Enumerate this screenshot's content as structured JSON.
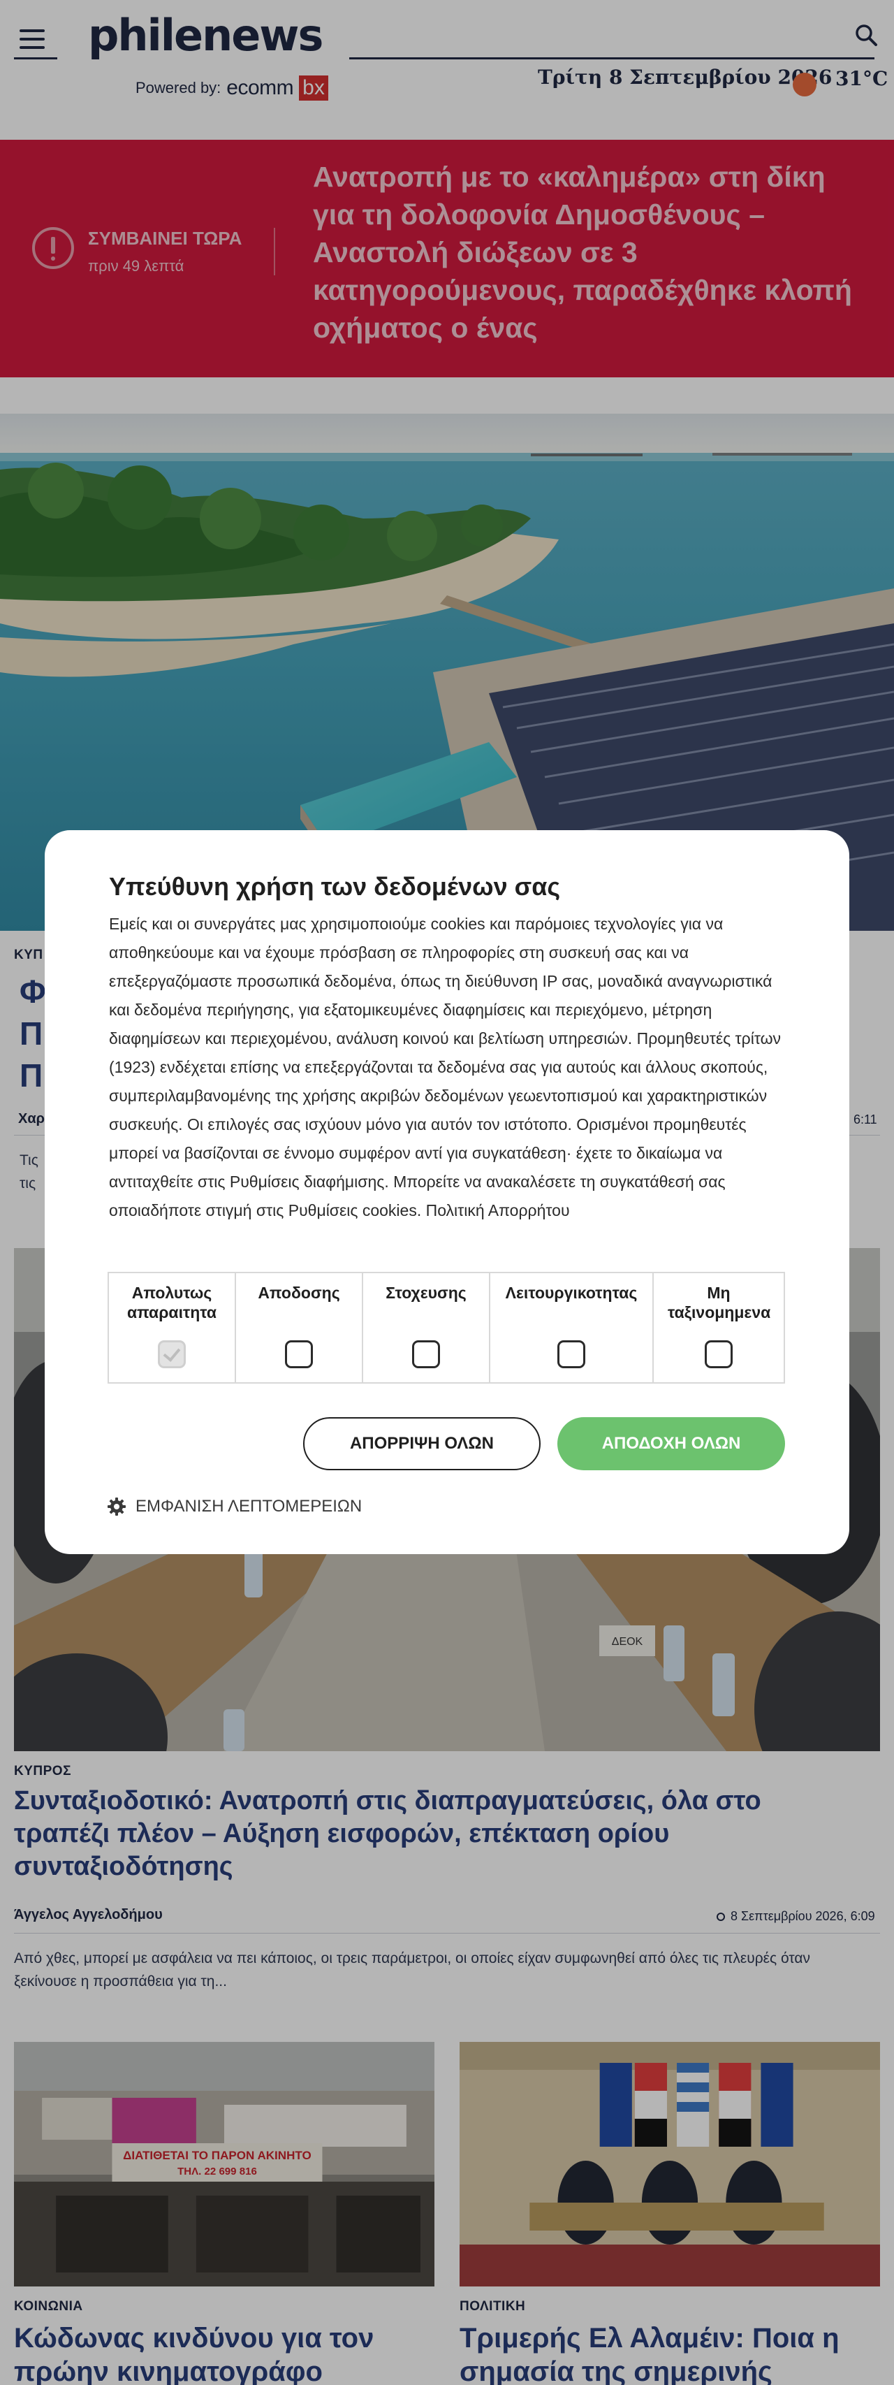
{
  "header": {
    "logo": "philenews",
    "powered_by": "Powered by:",
    "sponsor_logo": "ecomm",
    "sponsor_logo_box": "bx",
    "date": "Τρίτη 8 Σεπτεμβρίου 2026",
    "temperature": "31°C"
  },
  "breaking": {
    "label": "ΣΥΜΒΑΙΝΕΙ ΤΩΡΑ",
    "time": "πριν 49 λεπτά",
    "title": "Ανατροπή με το «καλημέρα» στη δίκη για τη δολοφονία Δημοσθένους – Αναστολή διώξεων σε 3 κατηγορούμενους, παραδέχθηκε κλοπή οχήματος ο ένας"
  },
  "article_featured": {
    "category_partial": "ΚΥΠ",
    "title_partial": [
      "Φ",
      "Π",
      "Π"
    ],
    "author_partial": "Χαρ",
    "time_partial": "6:11",
    "excerpt_partial": [
      "Τις",
      "τις"
    ]
  },
  "article_second": {
    "category": "ΚΥΠΡΟΣ",
    "title": "Συνταξιοδοτικό: Ανατροπή στις διαπραγματεύσεις, όλα στο τραπέζι πλέον – Αύξηση εισφορών, επέκταση ορίου συνταξιοδότησης",
    "author": "Άγγελος Αγγελοδήμου",
    "date": "8 Σεπτεμβρίου 2026, 6:09",
    "excerpt": "Από χθες, μπορεί με ασφάλεια να πει κάποιος, οι τρεις παράμετροι, οι οποίες είχαν συμφωνηθεί από όλες τις πλευρές όταν ξεκίνουσε η προσπάθεια για τη...",
    "photo_labels": [
      "ΔΕΟΚ"
    ]
  },
  "article_third": {
    "category": "ΚΟΙΝΩΝΙΑ",
    "title": "Κώδωνας κινδύνου για τον πρώην κινηματογράφο",
    "photo_sign": "ΔΙΑΤΙΘΕΤΑΙ ΤΟ ΠΑΡΟΝ ΑΚΙΝΗΤΟ",
    "photo_sign_phone": "ΤΗΛ. 22 699 816"
  },
  "article_fourth": {
    "category": "ΠΟΛΙΤΙΚΗ",
    "title": "Τριμερής Ελ Αλαμέιν: Ποια η σημασία της σημερινής"
  },
  "consent": {
    "title": "Υπεύθυνη χρήση των δεδομένων σας",
    "body": "Εμείς και οι συνεργάτες μας χρησιμοποιούμε cookies και παρόμοιες τεχνολογίες για να αποθηκεύουμε και να έχουμε πρόσβαση σε πληροφορίες στη συσκευή σας και να επεξεργαζόμαστε προσωπικά δεδομένα, όπως τη διεύθυνση IP σας, μοναδικά αναγνωριστικά και δεδομένα περιήγησης, για εξατομικευμένες διαφημίσεις και περιεχόμενο, μέτρηση διαφημίσεων και περιεχομένου, ανάλυση κοινού και βελτίωση υπηρεσιών. Προμηθευτές τρίτων (1923) ενδέχεται επίσης να επεξεργάζονται τα δεδομένα σας για αυτούς και άλλους σκοπούς, συμπεριλαμβανομένης της χρήσης ακριβών δεδομένων γεωεντοπισμού και χαρακτηριστικών συσκευής. Οι επιλογές σας ισχύουν μόνο για αυτόν τον ιστότοπο. Ορισμένοι προμηθευτές μπορεί να βασίζονται σε έννομο συμφέρον αντί για συγκατάθεση· έχετε το δικαίωμα να αντιταχθείτε στις Ρυθμίσεις διαφήμισης. Μπορείτε να ανακαλέσετε τη συγκατάθεσή σας οποιαδήποτε στιγμή στις Ρυθμίσεις cookies. Πολιτική Απορρήτου",
    "categories": [
      {
        "label": "Απολυτως απαραιτητα",
        "checked": true,
        "disabled": true
      },
      {
        "label": "Αποδοσης",
        "checked": false,
        "disabled": false
      },
      {
        "label": "Στοχευσης",
        "checked": false,
        "disabled": false
      },
      {
        "label": "Λειτουργικοτητας",
        "checked": false,
        "disabled": false
      },
      {
        "label": "Μη ταξινομημενα",
        "checked": false,
        "disabled": false
      }
    ],
    "reject_label": "ΑΠΟΡΡΙΨΗ ΟΛΩΝ",
    "accept_label": "ΑΠΟΔΟΧΗ ΟΛΩΝ",
    "details_label": "ΕΜΦΑΝΙΣΗ ΛΕΠΤΟΜΕΡΕΙΩΝ"
  },
  "colors": {
    "brand_navy": "#1c2540",
    "breaking_red": "#d1163c",
    "title_blue": "#253a78",
    "accept_green": "#6cc26e"
  }
}
